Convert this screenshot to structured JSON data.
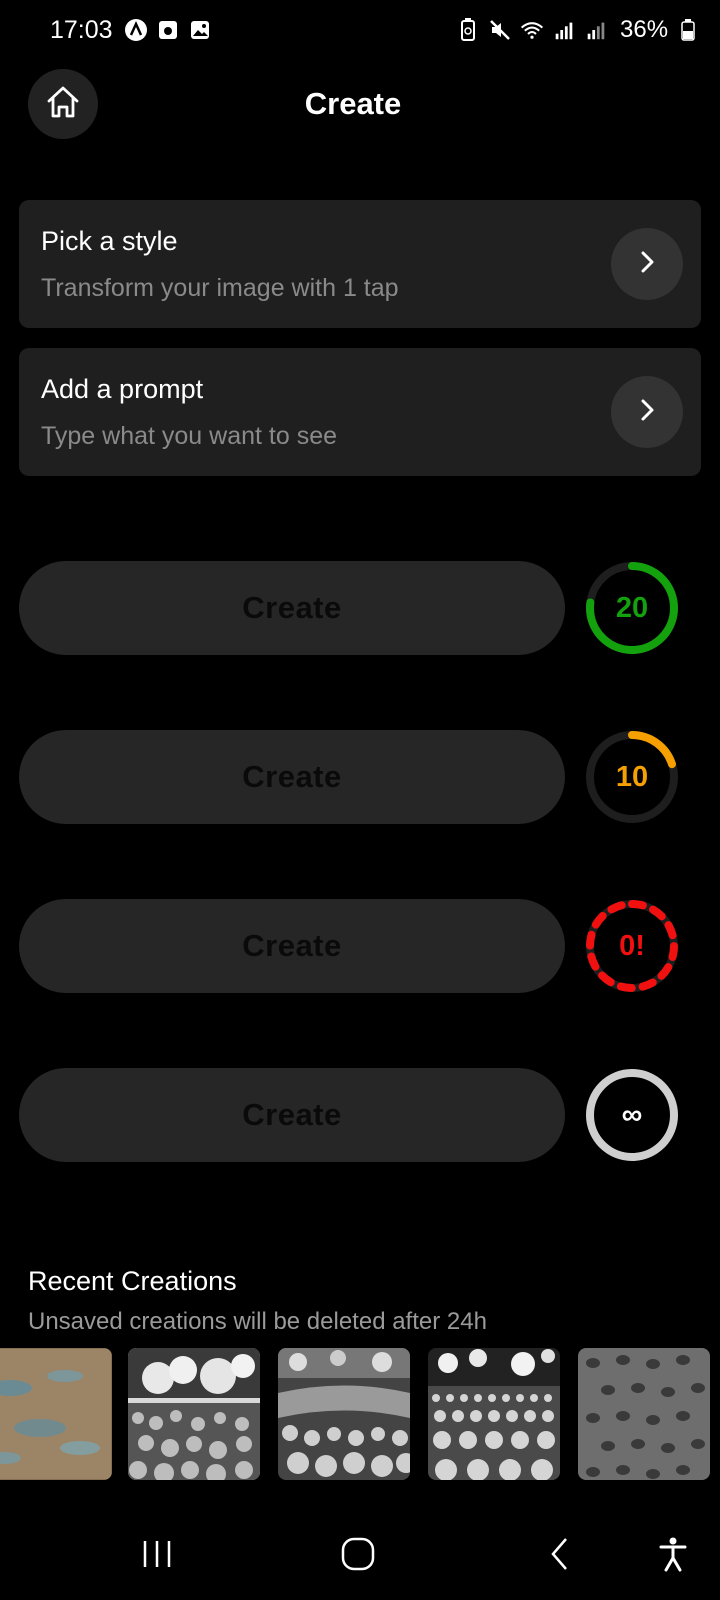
{
  "status_bar": {
    "time": "17:03",
    "battery": "36%",
    "left_icons": [
      "a-app-icon",
      "camera-icon",
      "image-icon"
    ],
    "right_icons": [
      "battery-saver-icon",
      "mute-icon",
      "wifi-icon",
      "signal-icon",
      "signal-icon"
    ]
  },
  "header": {
    "title": "Create",
    "home_icon": "home-icon"
  },
  "options": [
    {
      "title": "Pick a style",
      "subtitle": "Transform your image with 1 tap",
      "arrow_icon": "chevron-right-icon"
    },
    {
      "title": "Add a prompt",
      "subtitle": "Type what you want to see",
      "arrow_icon": "chevron-right-icon"
    }
  ],
  "create_rows": [
    {
      "button_label": "Create",
      "counter": "20",
      "color": "#13a10e",
      "fill_fraction": 0.77,
      "style": "solid"
    },
    {
      "button_label": "Create",
      "counter": "10",
      "color": "#f5a000",
      "fill_fraction": 0.2,
      "style": "solid"
    },
    {
      "button_label": "Create",
      "counter": "0!",
      "color": "#f01010",
      "fill_fraction": 1.0,
      "style": "dashed"
    },
    {
      "button_label": "Create",
      "counter": "∞",
      "color": "#cfcfcf",
      "fill_fraction": 1.0,
      "style": "solid"
    }
  ],
  "recent": {
    "title": "Recent Creations",
    "subtitle": "Unsaved creations will be deleted after 24h",
    "thumbnails": [
      "texture-tan-blue",
      "clouds-over-bushes",
      "landscape-valley",
      "field-of-bushes",
      "stone-texture"
    ]
  },
  "nav_bar": {
    "items": [
      "recent-apps-icon",
      "home-circle-icon",
      "back-icon",
      "accessibility-icon"
    ]
  },
  "colors": {
    "background": "#000000",
    "card": "#1f1f1f",
    "button": "#262626"
  }
}
